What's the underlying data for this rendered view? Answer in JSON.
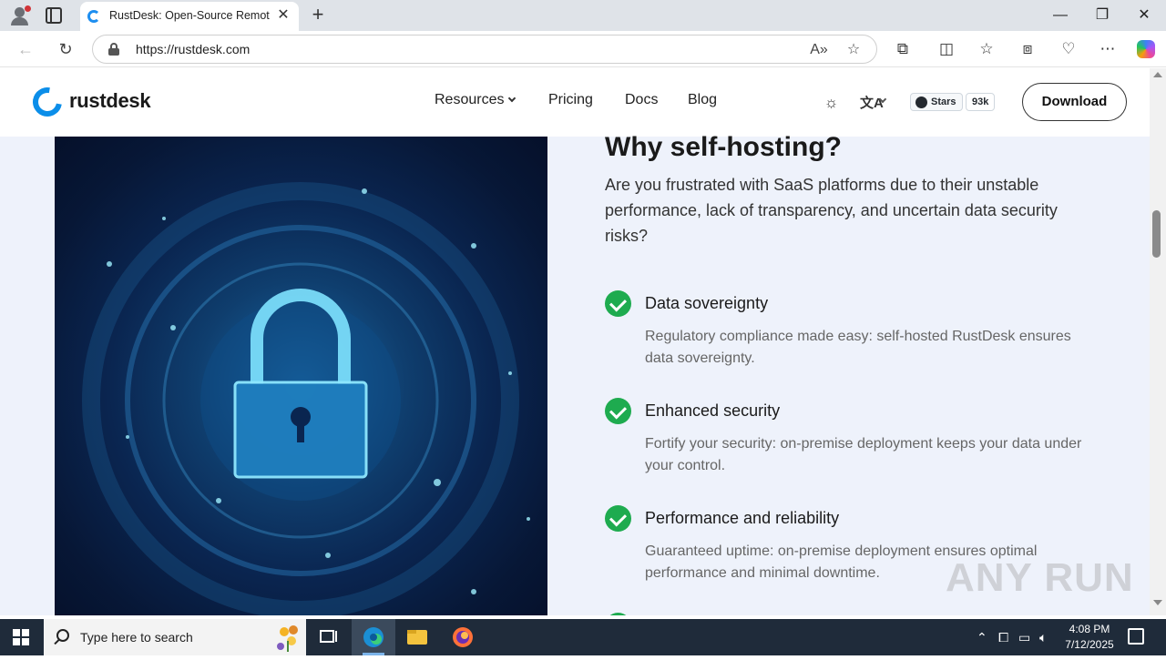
{
  "browser": {
    "tab_title": "RustDesk: Open-Source Remote D",
    "tab_close": "✕",
    "new_tab": "+",
    "url": "https://rustdesk.com",
    "minimize": "—",
    "maximize": "❐",
    "close": "✕"
  },
  "site": {
    "logo": "rustdesk",
    "nav": [
      "Resources",
      "Pricing",
      "Docs",
      "Blog"
    ],
    "lang": "文A",
    "github_stars_label": "Stars",
    "github_stars_count": "93k",
    "download": "Download"
  },
  "content": {
    "title": "Why self-hosting?",
    "intro": "Are you frustrated with SaaS platforms due to their unstable performance, lack of transparency, and uncertain data security risks?",
    "features": [
      {
        "title": "Data sovereignty",
        "desc": "Regulatory compliance made easy: self-hosted RustDesk ensures data sovereignty."
      },
      {
        "title": "Enhanced security",
        "desc": "Fortify your security: on-premise deployment keeps your data under your control."
      },
      {
        "title": "Performance and reliability",
        "desc": "Guaranteed uptime: on-premise deployment ensures optimal performance and minimal downtime."
      }
    ]
  },
  "watermark": "ANY RUN",
  "taskbar": {
    "search_placeholder": "Type here to search",
    "time": "4:08 PM",
    "date": "7/12/2025"
  },
  "colors": {
    "accent": "#0b8ee9",
    "check": "#1eab4f"
  }
}
